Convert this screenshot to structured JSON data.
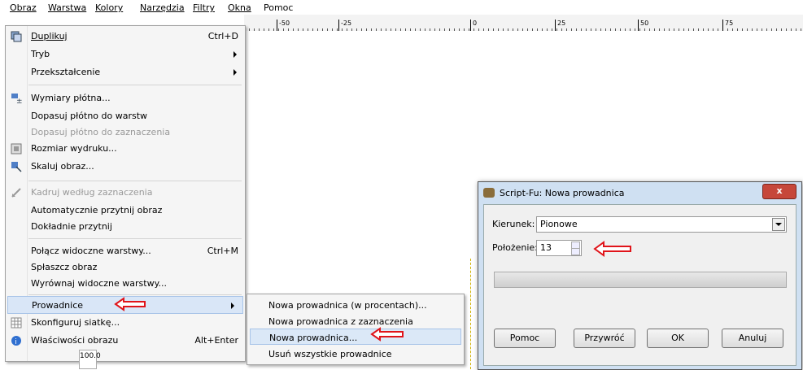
{
  "menubar": {
    "items": [
      "Obraz",
      "Warstwa",
      "Kolory",
      "Narzędzia",
      "Filtry",
      "Okna",
      "Pomoc"
    ]
  },
  "ruler": {
    "ticks": [
      "-50",
      "-25",
      "0",
      "25",
      "50",
      "75"
    ]
  },
  "image_menu": {
    "items": [
      {
        "label": "Duplikuj",
        "shortcut": "Ctrl+D",
        "icon": "duplicate-icon"
      },
      {
        "label": "Tryb",
        "submenu": true
      },
      {
        "label": "Przekształcenie",
        "submenu": true
      },
      {
        "label": "Wymiary płótna...",
        "icon": "canvas-size-icon"
      },
      {
        "label": "Dopasuj płótno do warstw"
      },
      {
        "label": "Dopasuj płótno do zaznaczenia",
        "disabled": true
      },
      {
        "label": "Rozmiar wydruku...",
        "icon": "print-size-icon"
      },
      {
        "label": "Skaluj obraz...",
        "icon": "scale-icon"
      },
      {
        "label": "Kadruj według zaznaczenia",
        "disabled": true,
        "icon": "crop-icon"
      },
      {
        "label": "Automatycznie przytnij obraz"
      },
      {
        "label": "Dokładnie przytnij"
      },
      {
        "label": "Połącz widoczne warstwy...",
        "shortcut": "Ctrl+M"
      },
      {
        "label": "Spłaszcz obraz"
      },
      {
        "label": "Wyrównaj widoczne warstwy..."
      },
      {
        "label": "Prowadnice",
        "submenu": true,
        "highlighted": true
      },
      {
        "label": "Skonfiguruj siatkę...",
        "icon": "grid-icon"
      },
      {
        "label": "Właściwości obrazu",
        "shortcut": "Alt+Enter",
        "icon": "info-icon"
      }
    ]
  },
  "guides_submenu": {
    "items": [
      {
        "label": "Nowa prowadnica (w procentach)..."
      },
      {
        "label": "Nowa prowadnica z zaznaczenia"
      },
      {
        "label": "Nowa prowadnica...",
        "highlighted": true
      },
      {
        "label": "Usuń wszystkie prowadnice"
      }
    ]
  },
  "zoom": {
    "value": "100.0"
  },
  "dialog": {
    "title": "Script-Fu: Nowa prowadnica",
    "close_label": "x",
    "direction_label": "Kierunek:",
    "direction_value": "Pionowe",
    "position_label": "Położenie:",
    "position_value": "13",
    "buttons": {
      "help": "Pomoc",
      "reset": "Przywróć",
      "ok": "OK",
      "cancel": "Anuluj"
    }
  },
  "colors": {
    "arrow": "#e0141a",
    "highlight": "#d9e6f7",
    "dialog_frame": "#cfe0f2"
  }
}
